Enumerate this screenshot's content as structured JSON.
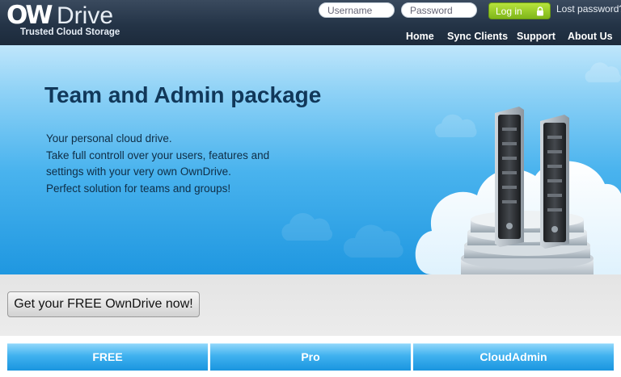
{
  "header": {
    "brand_ow": "OW",
    "brand_drive": "Drive",
    "tagline": "Trusted Cloud Storage",
    "username_placeholder": "Username",
    "password_placeholder": "Password",
    "login_label": "Log in",
    "lost_password": "Lost password?",
    "nav": [
      "Home",
      "Sync Clients",
      "Support",
      "About Us"
    ]
  },
  "hero": {
    "title": "Team and Admin package",
    "lines": [
      "Your personal cloud drive.",
      "Take full controll over your users, features and",
      "settings with your very own OwnDrive.",
      "Perfect solution for teams and groups!"
    ]
  },
  "cta": {
    "label": "Get your FREE OwnDrive now!"
  },
  "plans": [
    "FREE",
    "Pro",
    "CloudAdmin"
  ],
  "colors": {
    "header_bg": "#243447",
    "hero_top": "#bfe6fb",
    "hero_bottom": "#1f97e0",
    "title": "#11385a",
    "login_green": "#8fc322",
    "plan_blue": "#3fb1ef"
  },
  "icons": {
    "login": "lock-icon",
    "hero_art": "servers-on-cloud-illustration"
  }
}
